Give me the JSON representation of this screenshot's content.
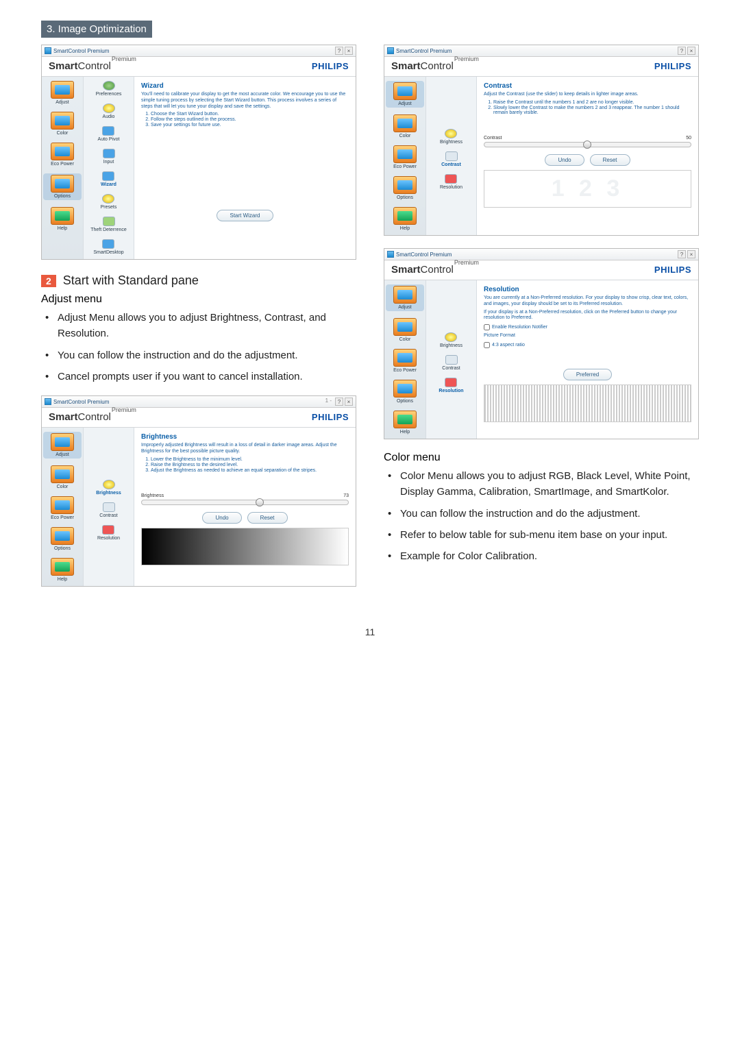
{
  "section_header": "3. Image Optimization",
  "page_number": "11",
  "brand": {
    "smart": "Smart",
    "control": "Control",
    "premium": "Premium",
    "philips": "PHILIPS"
  },
  "titlebar": {
    "app": "SmartControl Premium",
    "help": "?",
    "close": "×",
    "extra": "1 -"
  },
  "nav": {
    "adjust": "Adjust",
    "color": "Color",
    "eco": "Eco Power",
    "options": "Options",
    "help": "Help"
  },
  "wizard_sub": {
    "preferences": "Preferences",
    "audio": "Audio",
    "autopivot": "Auto Pivot",
    "input": "Input",
    "wizard": "Wizard",
    "presets": "Presets",
    "theft": "Theft Deterrence",
    "smartdesktop": "SmartDesktop"
  },
  "adjust_sub": {
    "brightness": "Brightness",
    "contrast": "Contrast",
    "resolution": "Resolution"
  },
  "buttons": {
    "start_wizard": "Start Wizard",
    "undo": "Undo",
    "reset": "Reset",
    "preferred": "Preferred"
  },
  "wizard_panel": {
    "title": "Wizard",
    "intro": "You'll need to calibrate your display to get the most accurate color. We encourage you to use the simple tuning process by selecting the Start Wizard button. This process involves a series of steps that will let you tune your display and save the settings.",
    "s1": "Choose the Start Wizard button.",
    "s2": "Follow the steps outlined in the process.",
    "s3": "Save your settings for future use."
  },
  "brightness_panel": {
    "title": "Brightness",
    "intro": "Improperly adjusted Brightness will result in a loss of detail in darker image areas. Adjust the Brightness for the best possible picture quality.",
    "s1": "Lower the Brightness to the minimum level.",
    "s2": "Raise the Brightness to the desired level.",
    "s3": "Adjust the Brightness as needed to achieve an equal separation of the stripes.",
    "label": "Brightness",
    "value": "73"
  },
  "contrast_panel": {
    "title": "Contrast",
    "intro": "Adjust the Contrast (use the slider) to keep details in lighter image areas.",
    "s1": "Raise the Contrast until the numbers 1 and 2 are no longer visible.",
    "s2": "Slowly lower the Contrast to make the numbers 2 and 3 reappear. The number 1 should remain barely visible.",
    "label": "Contrast",
    "value": "50",
    "preview": "1 2 3"
  },
  "resolution_panel": {
    "title": "Resolution",
    "p1": "You are currently at a Non-Preferred resolution. For your display to show crisp, clear text, colors, and images, your display should be set to its Preferred resolution.",
    "p2": "If your display is at a Non-Preferred resolution, click on the Preferred button to change your resolution to Preferred.",
    "chk": "Enable Resolution Notifier",
    "pf": "Picture Format",
    "ar": "4:3 aspect ratio"
  },
  "doc": {
    "step2_title": "Start with Standard pane",
    "adjust_h": "Adjust menu",
    "adjust_b1": "Adjust Menu allows you to adjust Brightness, Contrast, and Resolution.",
    "adjust_b2": "You can follow the instruction and do the adjustment.",
    "adjust_b3": "Cancel prompts user if you want to cancel installation.",
    "color_h": "Color menu",
    "color_b1": "Color Menu allows you to adjust RGB, Black Level, White Point, Display Gamma, Calibration, SmartImage, and SmartKolor.",
    "color_b2": "You can follow the instruction and do the adjustment.",
    "color_b3": "Refer to below table for sub-menu item base on your input.",
    "color_b4": "Example for Color Calibration."
  }
}
